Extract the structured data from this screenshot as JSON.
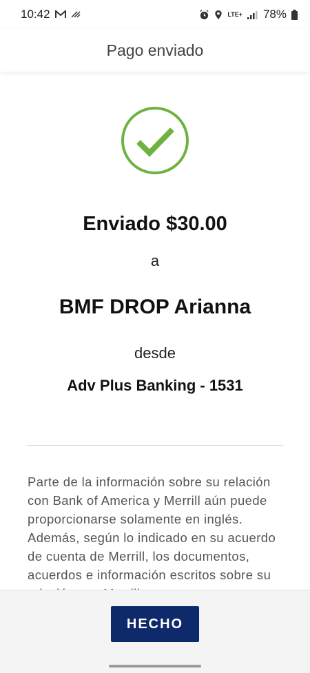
{
  "status_bar": {
    "time": "10:42",
    "battery": "78%",
    "network": "LTE+"
  },
  "header": {
    "title": "Pago enviado"
  },
  "confirmation": {
    "check_color": "#6db33f",
    "sent_amount": "Enviado $30.00",
    "to_label": "a",
    "recipient": "BMF DROP Arianna",
    "from_label": "desde",
    "account": "Adv Plus Banking - 1531"
  },
  "disclaimer": {
    "text": "Parte de la información sobre su relación con Bank of America y Merrill aún puede proporcionarse solamente en inglés. Además, según lo indicado en su acuerdo de cuenta de Merrill, los documentos, acuerdos e información escritos sobre su relación con Merrill"
  },
  "footer": {
    "done_label": "HECHO",
    "button_color": "#0f2a6b"
  }
}
